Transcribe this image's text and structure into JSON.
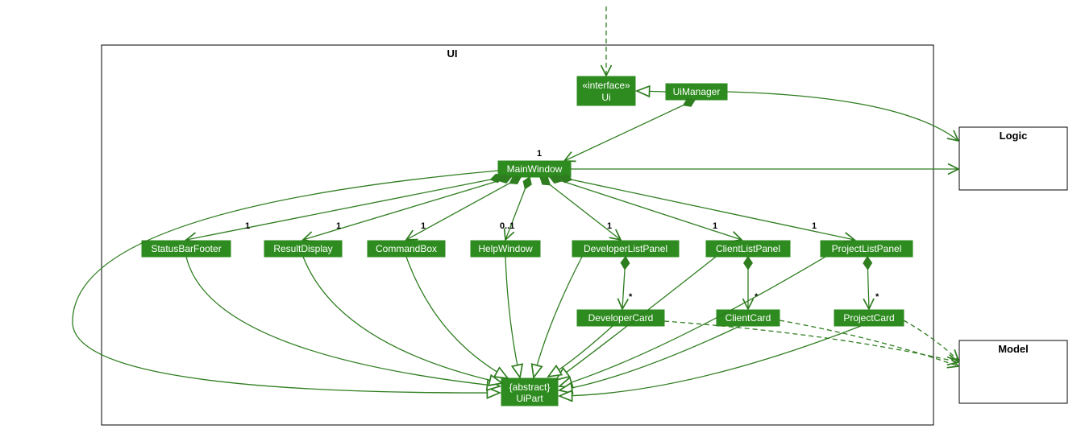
{
  "package": {
    "main": "UI",
    "external1": "Logic",
    "external2": "Model"
  },
  "nodes": {
    "ui": {
      "stereotype": "«interface»",
      "name": "Ui"
    },
    "uiManager": "UiManager",
    "mainWindow": "MainWindow",
    "statusBarFooter": "StatusBarFooter",
    "resultDisplay": "ResultDisplay",
    "commandBox": "CommandBox",
    "helpWindow": "HelpWindow",
    "developerListPanel": "DeveloperListPanel",
    "clientListPanel": "ClientListPanel",
    "projectListPanel": "ProjectListPanel",
    "developerCard": "DeveloperCard",
    "clientCard": "ClientCard",
    "projectCard": "ProjectCard",
    "uiPart": {
      "stereotype": "{abstract}",
      "name": "UiPart"
    }
  },
  "multiplicities": {
    "mainWindow": "1",
    "statusBarFooter": "1",
    "resultDisplay": "1",
    "commandBox": "1",
    "helpWindow": "0..1",
    "developerListPanel": "1",
    "clientListPanel": "1",
    "projectListPanel": "1",
    "developerCard": "*",
    "clientCard": "*",
    "projectCard": "*"
  }
}
